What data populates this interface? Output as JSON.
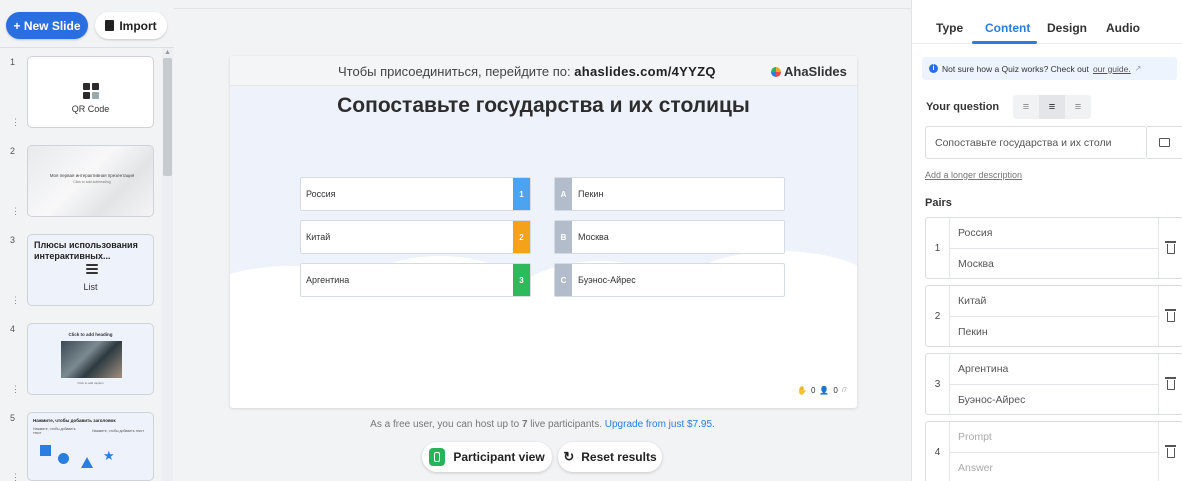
{
  "sidebar": {
    "new_slide": "+ New Slide",
    "import": "Import",
    "slides": [
      {
        "num": "1",
        "label": "QR Code"
      },
      {
        "num": "2",
        "title": "Моя первая интерактивная презентация",
        "subtitle": "Click to add subheading"
      },
      {
        "num": "3",
        "title": "Плюсы использования интерактивных...",
        "label": "List"
      },
      {
        "num": "4",
        "title": "Click to add heading",
        "caption": "Click to add caption"
      },
      {
        "num": "5",
        "title": "Нажмите, чтобы добавить заголовок",
        "sub1": "Нажмите, чтобы добавить текст",
        "sub2": "Нажмите, чтобы добавить текст"
      }
    ]
  },
  "canvas": {
    "join_prefix": "Чтобы присоединиться, перейдите по: ",
    "join_url": "ahaslides.com/4YYZQ",
    "brand": "AhaSlides",
    "title": "Сопоставьте государства и их столицы",
    "left_items": [
      {
        "text": "Россия",
        "num": "1",
        "color": "#4da3ee"
      },
      {
        "text": "Китай",
        "num": "2",
        "color": "#f5a21b"
      },
      {
        "text": "Аргентина",
        "num": "3",
        "color": "#2dba5a"
      }
    ],
    "right_items": [
      {
        "letter": "A",
        "text": "Пекин"
      },
      {
        "letter": "B",
        "text": "Москва"
      },
      {
        "letter": "C",
        "text": "Буэнос-Айрес"
      }
    ],
    "responses": "0",
    "participants": "0",
    "participants_max": "/7"
  },
  "footer": {
    "note_prefix": "As a free user, you can host up to ",
    "note_limit": "7",
    "note_mid": " live participants. ",
    "note_link": "Upgrade from just $7.95.",
    "participant_view": "Participant view",
    "reset_results": "Reset results"
  },
  "panel": {
    "tabs": [
      "Type",
      "Content",
      "Design",
      "Audio"
    ],
    "active_tab": "Content",
    "info_text": "Not sure how a Quiz works? Check out ",
    "info_link": "our guide.",
    "your_question": "Your question",
    "question_value": "Сопоставьте государства и их столи",
    "add_longer": "Add a longer description",
    "pairs_label": "Pairs",
    "pairs": [
      {
        "n": "1",
        "prompt": "Россия",
        "answer": "Москва"
      },
      {
        "n": "2",
        "prompt": "Китай",
        "answer": "Пекин"
      },
      {
        "n": "3",
        "prompt": "Аргентина",
        "answer": "Буэнос-Айрес"
      },
      {
        "n": "4",
        "prompt": "",
        "answer": "",
        "prompt_placeholder": "Prompt",
        "answer_placeholder": "Answer"
      }
    ]
  },
  "colors": {
    "accent": "#2a7de1",
    "brand_blue": "#2a6fe0",
    "green": "#27b35a"
  }
}
